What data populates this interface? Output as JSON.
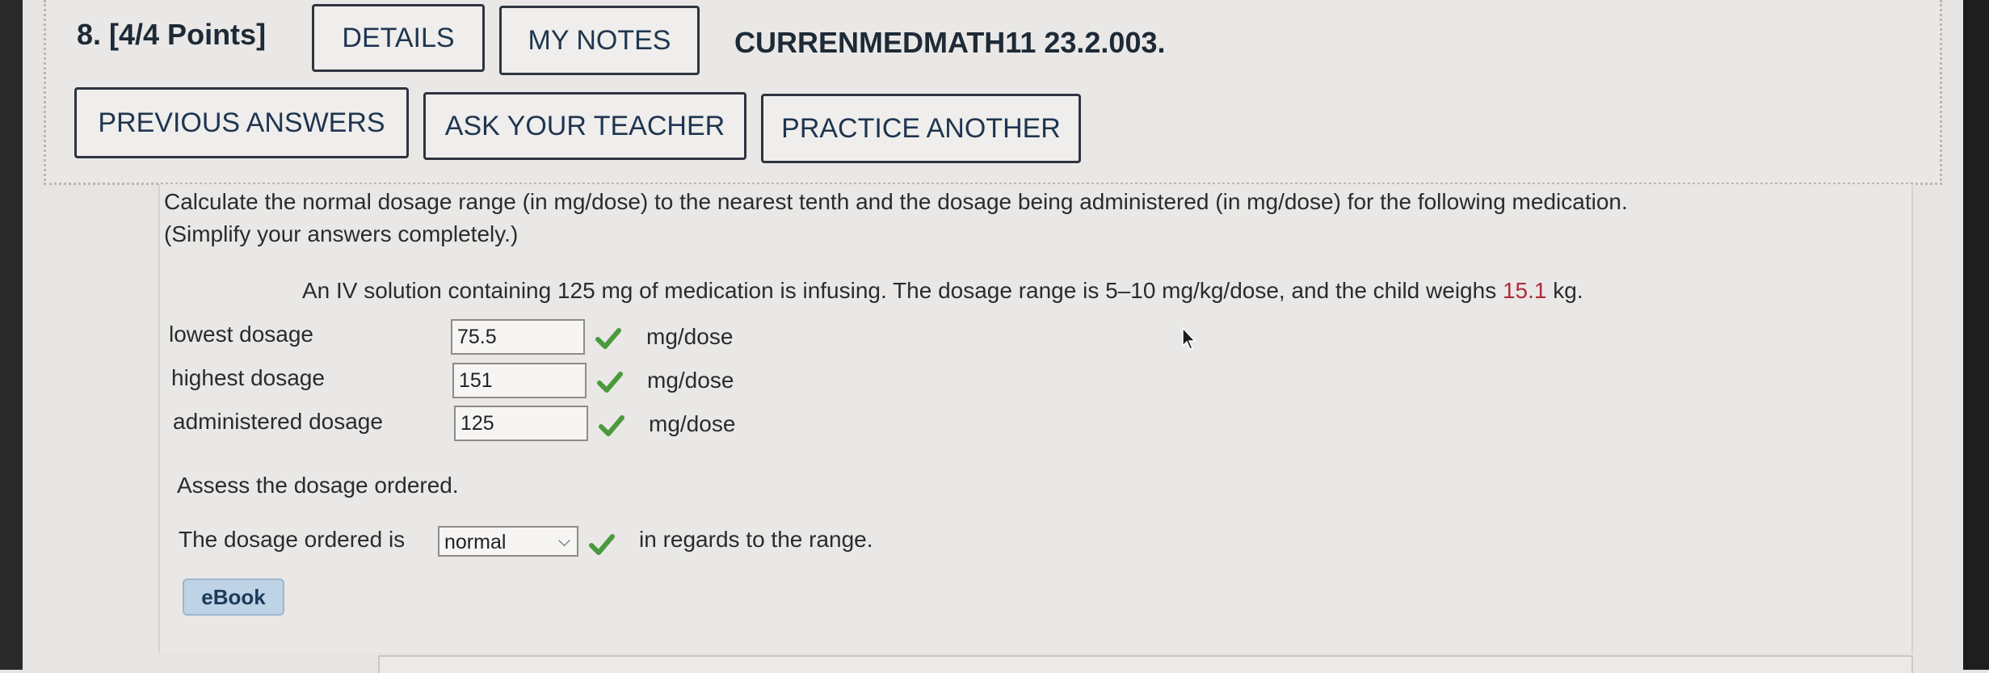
{
  "question": {
    "header": "8. [4/4 Points]",
    "code": "CURRENMEDMATH11 23.2.003."
  },
  "buttons": {
    "details": "DETAILS",
    "my_notes": "MY NOTES",
    "previous_answers": "PREVIOUS ANSWERS",
    "ask_teacher": "ASK YOUR TEACHER",
    "practice_another": "PRACTICE ANOTHER"
  },
  "prompt": {
    "line1": "Calculate the normal dosage range (in mg/dose) to the nearest tenth and the dosage being administered (in mg/dose) for the following medication.",
    "line2": "(Simplify your answers completely.)",
    "scenario_pre": "An IV solution containing 125 mg of medication is infusing. The dosage range is 5–10 mg/kg/dose, and the child weighs ",
    "weight": "15.1",
    "scenario_post": " kg."
  },
  "answers": [
    {
      "label": "lowest dosage",
      "value": "75.5",
      "unit": "mg/dose"
    },
    {
      "label": "highest dosage",
      "value": "151",
      "unit": "mg/dose"
    },
    {
      "label": "administered dosage",
      "value": "125",
      "unit": "mg/dose"
    }
  ],
  "assess": {
    "heading": "Assess the dosage ordered.",
    "sentence_pre": "The dosage ordered is",
    "selected": "normal",
    "sentence_post": "in regards to the range."
  },
  "ebook_label": "eBook",
  "colors": {
    "check_green": "#4a9a3c",
    "highlight_red": "#b02a3a"
  }
}
